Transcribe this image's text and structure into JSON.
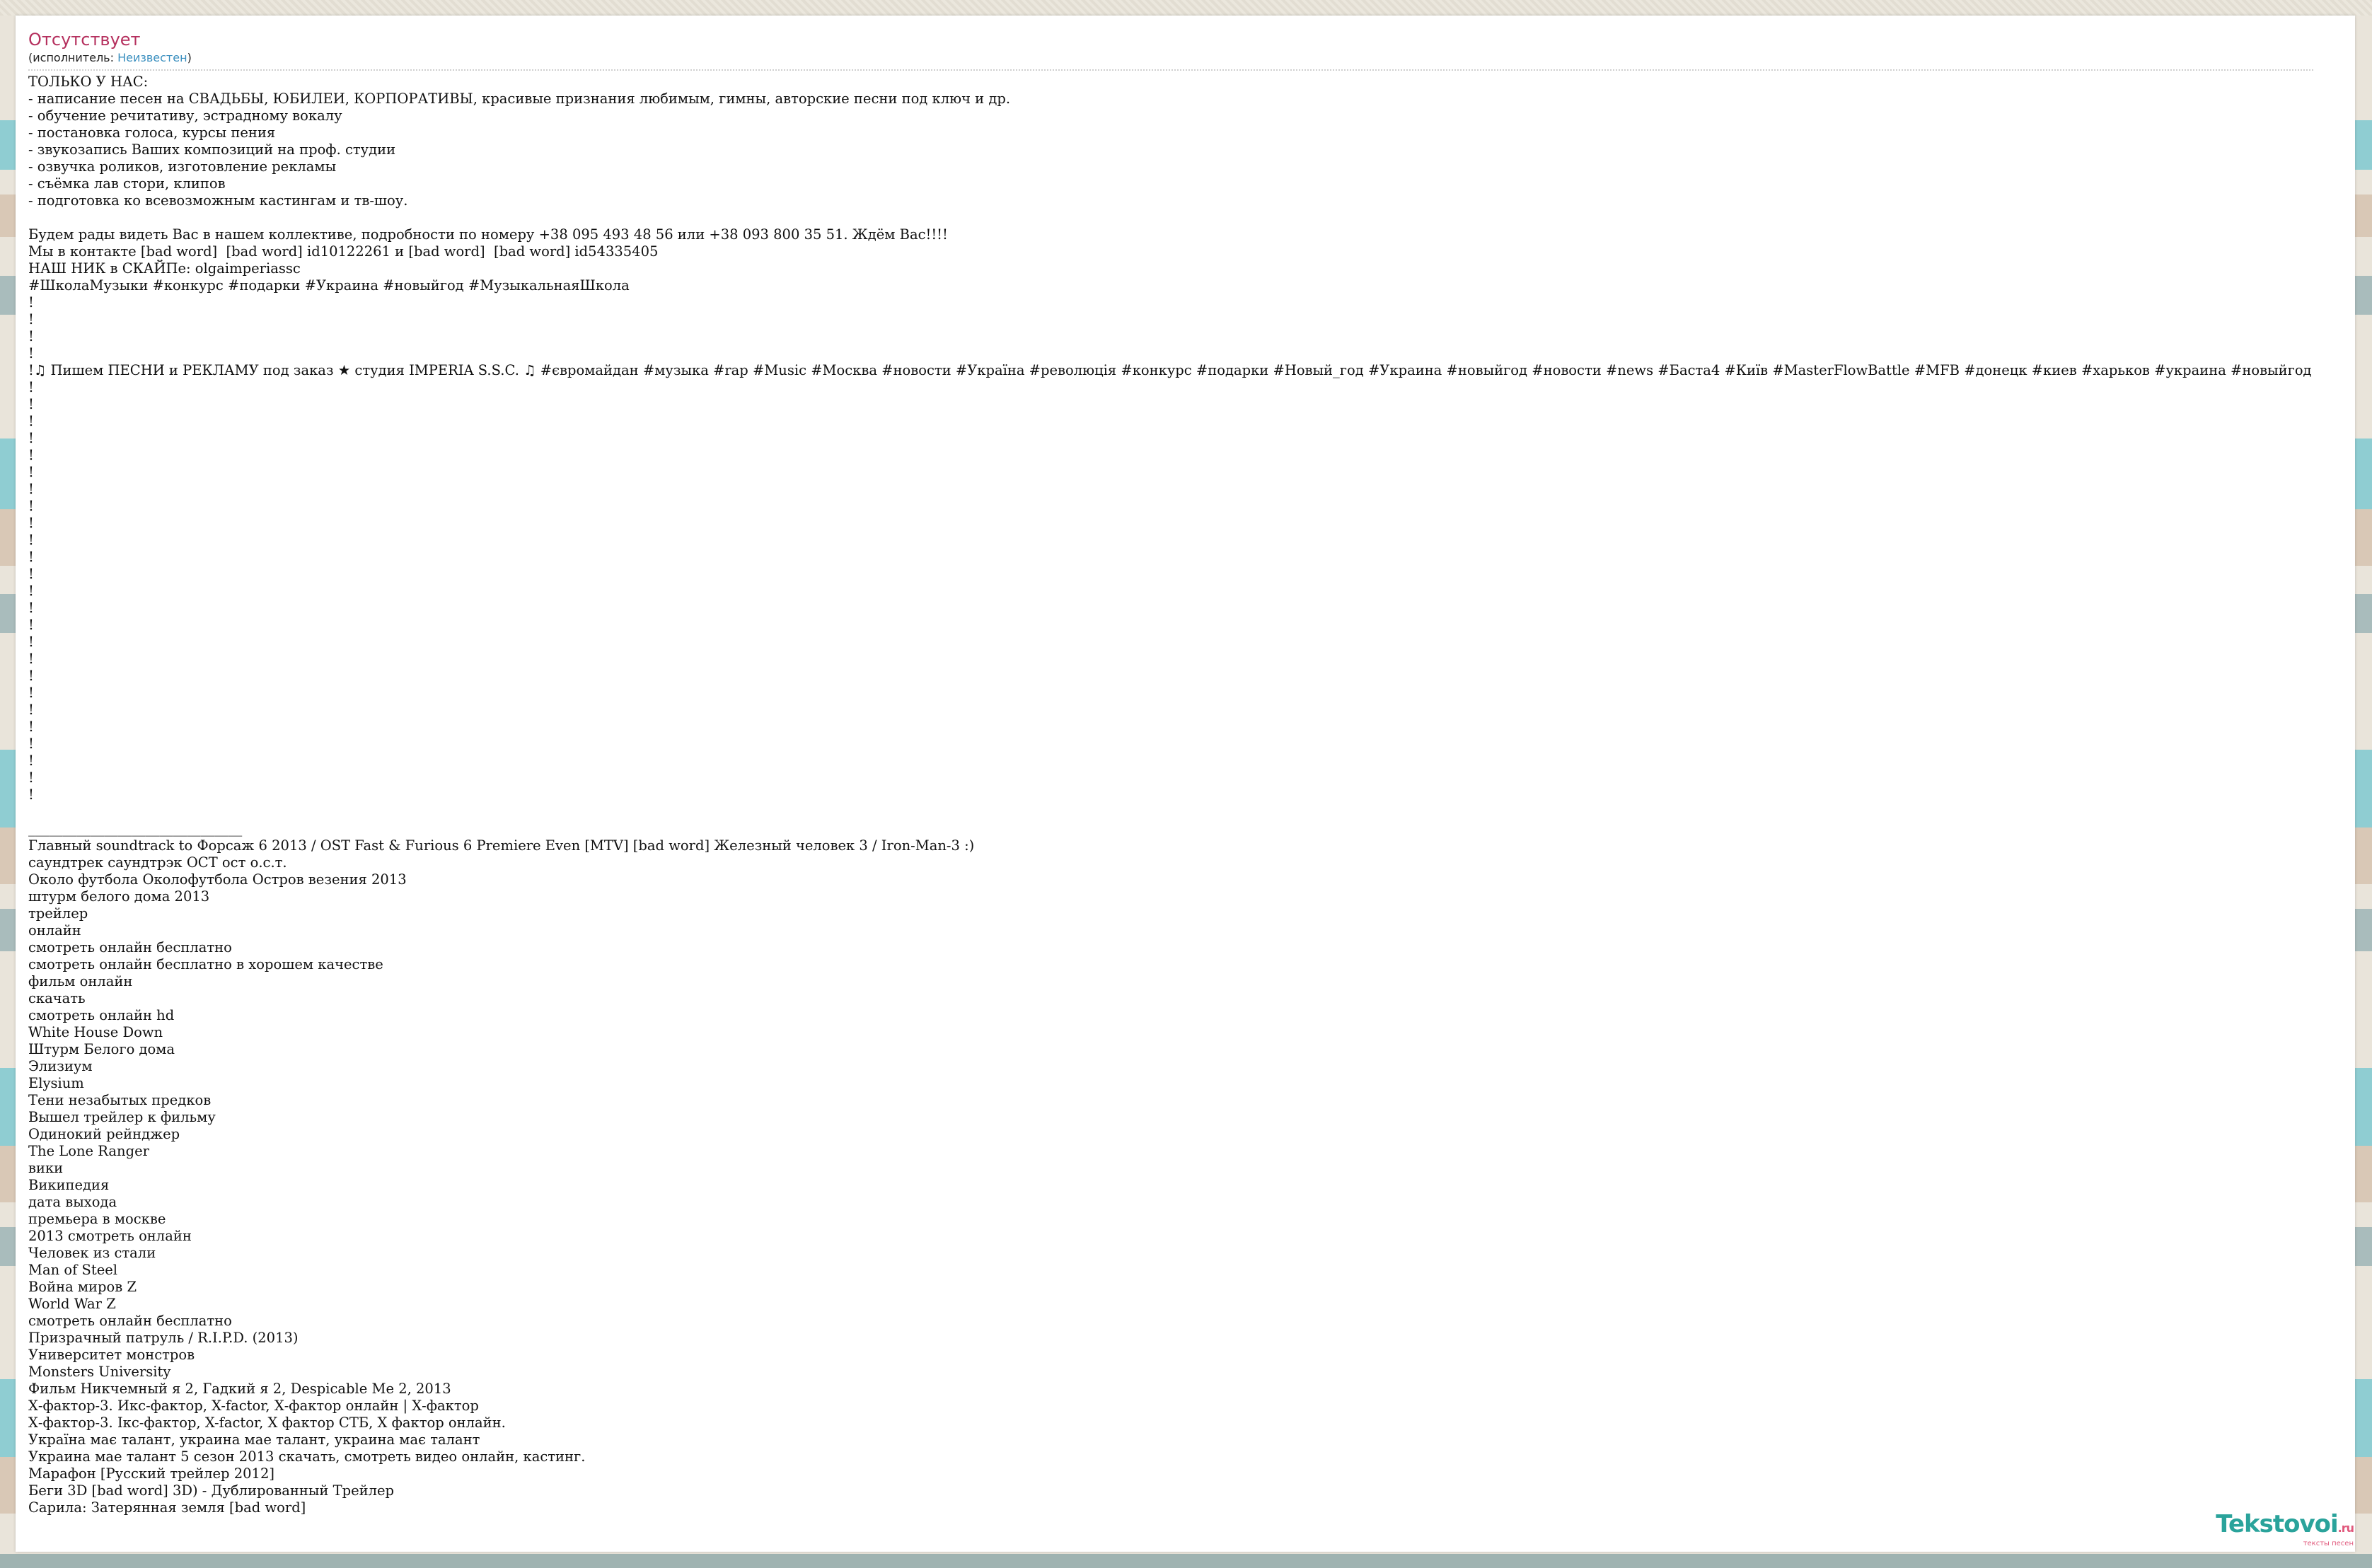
{
  "song": {
    "title": "Отсутствует",
    "artist_prefix": "(исполнитель: ",
    "artist": "Неизвестен",
    "artist_suffix": ")"
  },
  "lyrics_lines": [
    "ТОЛЬКО У НАС:",
    "- написание песен на СВАДЬБЫ, ЮБИЛЕИ, КОРПОРАТИВЫ, красивые признания любимым, гимны, авторские песни под ключ и др.",
    "- обучение речитативу, эстрадному вокалу",
    "- постановка голоса, курсы пения",
    "- звукозапись Ваших композиций на проф. студии",
    "- озвучка роликов, изготовление рекламы",
    "- съёмка лав стори, клипов",
    "- подготовка ко всевозможным кастингам и тв-шоу.",
    "",
    "Будем рады видеть Вас в нашем коллективе, подробности по номеру +38 095 493 48 56 или +38 093 800 35 51. Ждём Вас!!!!",
    "Мы в контакте [bad word]  [bad word] id10122261 и [bad word]  [bad word] id54335405",
    "НАШ НИК в СКАЙПе: olgaimperiassc",
    "#ШколаМузыки #конкурс #подарки #Украина #новыйгод #МузыкальнаяШкола",
    "!",
    "!",
    "!",
    "!",
    "!♫ Пишем ПЕСНИ и РЕКЛАМУ под заказ ★ студия IMPERIA S.S.C. ♫ #євромайдан #музыка #rap #Music #Москва #новости #Україна #революція #конкурс #подарки #Новый_год #Украина #новыйгод #новости #news #Баста4 #Київ #MasterFlowBattle #MFB #донецк #киев #харьков #украина #новыйгод",
    "!",
    "!",
    "!",
    "!",
    "!",
    "!",
    "!",
    "!",
    "!",
    "!",
    "!",
    "!",
    "!",
    "!",
    "!",
    "!",
    "!",
    "!",
    "!",
    "!",
    "!",
    "!",
    "!",
    "!",
    "!",
    "",
    "_______________________________",
    "Главный soundtrack to Форсаж 6 2013 / OST Fast & Furious 6 Premiere Even [MTV] [bad word] Железный человек 3 / Iron-Man-3 :)",
    "саундтрек саундтрэк ОСТ ост о.с.т.",
    "Около футбола Околофутбола Остров везения 2013",
    "штурм белого дома 2013",
    "трейлер",
    "онлайн",
    "смотреть онлайн бесплатно",
    "смотреть онлайн бесплатно в хорошем качестве",
    "фильм онлайн",
    "скачать",
    "смотреть онлайн hd",
    "White House Down",
    "Штурм Белого дома",
    "Элизиум",
    "Elysium",
    "Тени незабытых предков",
    "Вышел трейлер к фильму",
    "Одинокий рейнджер",
    "The Lone Ranger",
    "вики",
    "Википедия",
    "дата выхода",
    "премьера в москве",
    "2013 смотреть онлайн",
    "Человек из стали",
    "Man of Steel",
    "Война миров Z",
    "World War Z",
    "смотреть онлайн бесплатно",
    "Призрачный патруль / R.I.P.D. (2013)",
    "Университет монстров",
    "Monsters University",
    "Фильм Никчемный я 2, Гадкий я 2, Despicable Me 2, 2013",
    "Х-фактор-3. Икс-фактор, X-factor, Х-фактор онлайн | Х-фактор",
    "Х-фактор-3. Ікс-фактор, X-factor, Х фактор СТБ, Х фактор онлайн.",
    "Україна має талант, украина мае талант, украина має талант",
    "Украина мае талант 5 сезон 2013 скачать, смотреть видео онлайн, кастинг.",
    "Марафон [Русский трейлер 2012]",
    "Беги 3D [bad word] 3D) - Дублированный Трейлер",
    "Сарила: Затерянная земля [bad word]"
  ],
  "logo": {
    "name": "Tekstovoi",
    "tld": ".ru",
    "tagline": "тексты песен"
  },
  "colors": {
    "title": "#b5305e",
    "artist_link": "#3a8fbf",
    "logo": "#2aa39b",
    "logo_accent": "#e0577b"
  }
}
